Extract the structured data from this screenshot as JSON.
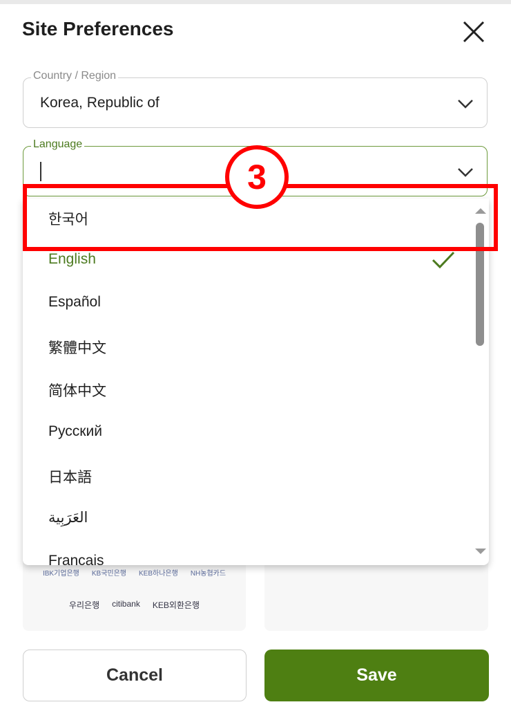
{
  "dialog": {
    "title": "Site Preferences",
    "close_icon": "close-icon"
  },
  "country_field": {
    "label": "Country / Region",
    "value": "Korea, Republic of"
  },
  "language_field": {
    "label": "Language",
    "value": ""
  },
  "language_options": [
    {
      "label": "한국어",
      "selected": false
    },
    {
      "label": "English",
      "selected": true
    },
    {
      "label": "Español",
      "selected": false
    },
    {
      "label": "繁體中文",
      "selected": false
    },
    {
      "label": "简体中文",
      "selected": false
    },
    {
      "label": "Русский",
      "selected": false
    },
    {
      "label": "日本語",
      "selected": false
    },
    {
      "label": "العَرَبِية",
      "selected": false
    },
    {
      "label": "Français",
      "selected": false
    }
  ],
  "annotation": {
    "step_number": "3",
    "color": "#ff0000"
  },
  "banks": {
    "row1": [
      "IBK기업은행",
      "KB국민은행",
      "KEB하나은행",
      "NH농협카드"
    ],
    "row2": [
      "우리은행",
      "citibank",
      "KEB외환은행"
    ]
  },
  "buttons": {
    "cancel_label": "Cancel",
    "save_label": "Save"
  },
  "colors": {
    "accent": "#4e7f12",
    "selected_text": "#4c7a1f"
  }
}
